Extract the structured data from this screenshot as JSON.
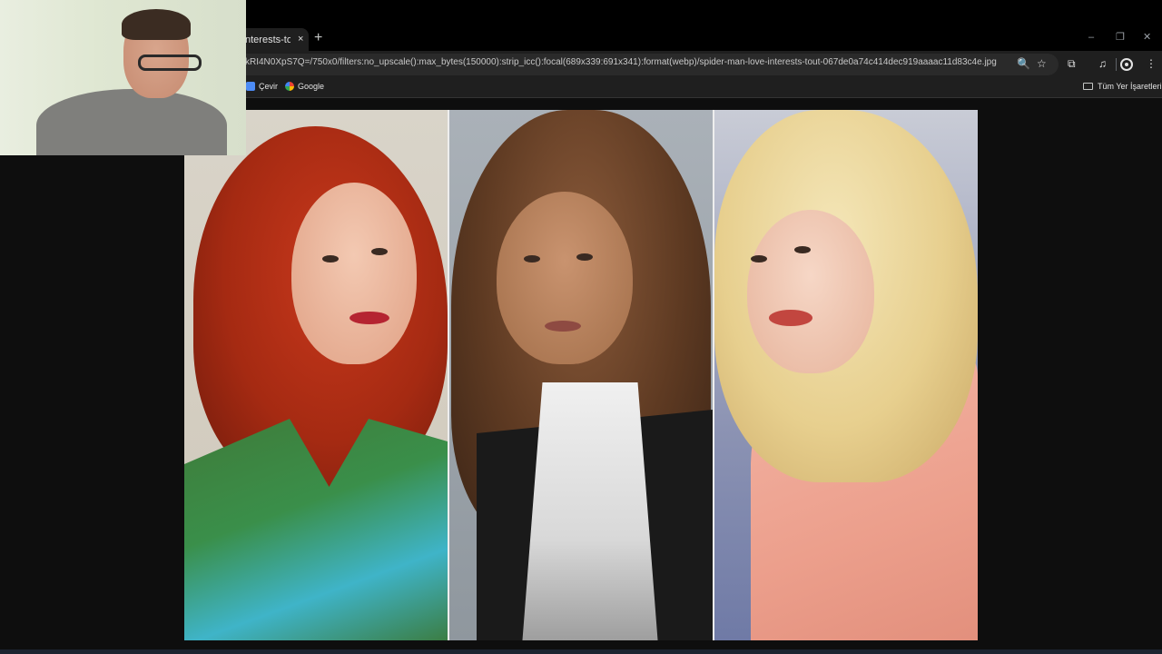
{
  "browser": {
    "tab": {
      "title": "nterests-tout",
      "close_glyph": "×"
    },
    "new_tab_glyph": "+",
    "window_controls": {
      "minimize": "–",
      "restore": "❐",
      "close": "✕"
    },
    "address_bar": {
      "url": "kRI4N0XpS7Q=/750x0/filters:no_upscale():max_bytes(150000):strip_icc():focal(689x339:691x341):format(webp)/spider-man-love-interests-tout-067de0a74c414dec919aaaac11d83c4e.jpg"
    },
    "toolbar_icons": {
      "zoom": "🔍",
      "bookmark_star": "☆",
      "extensions": "⧉",
      "media": "♫"
    },
    "bookmarks": {
      "items": [
        {
          "label": "Çevir",
          "icon": "translate-icon"
        },
        {
          "label": "Google",
          "icon": "google-icon"
        }
      ],
      "all_bookmarks": "Tüm Yer İşaretleri"
    }
  },
  "colors": {
    "tabstrip_bg": "#000000",
    "toolbar_bg": "#1f1f1f",
    "content_bg": "#0e0e0e"
  }
}
